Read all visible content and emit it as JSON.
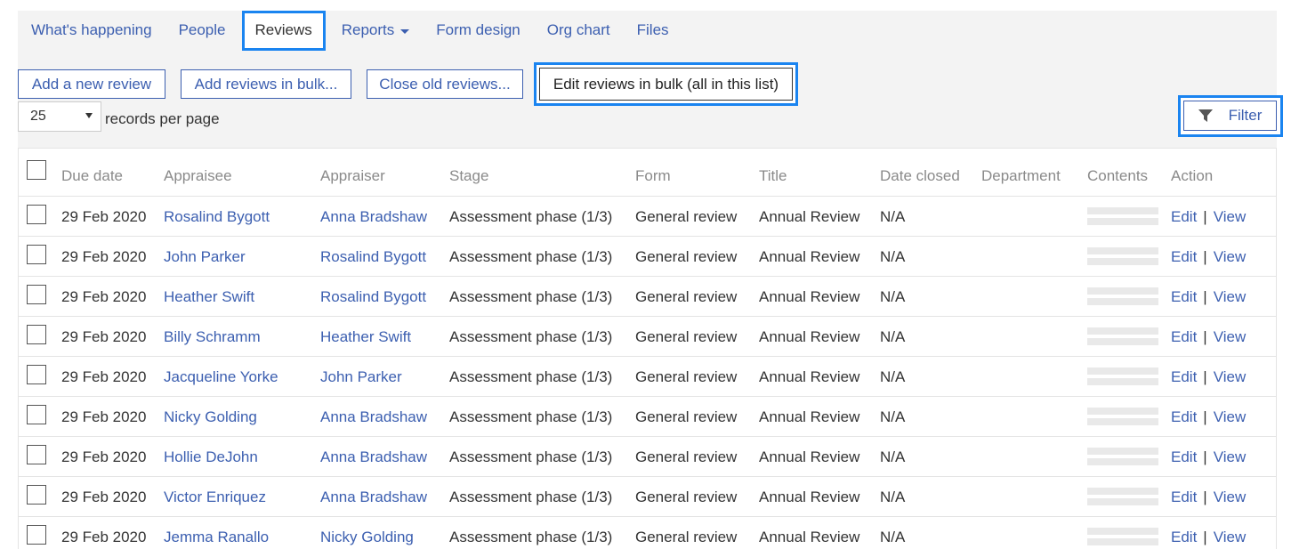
{
  "nav": {
    "items": [
      {
        "label": "What's happening"
      },
      {
        "label": "People"
      },
      {
        "label": "Reviews"
      },
      {
        "label": "Reports"
      },
      {
        "label": "Form design"
      },
      {
        "label": "Org chart"
      },
      {
        "label": "Files"
      }
    ]
  },
  "toolbar": {
    "add_review": "Add a new review",
    "add_bulk": "Add reviews in bulk...",
    "close_old": "Close old reviews...",
    "edit_bulk": "Edit reviews in bulk (all in this list)"
  },
  "perpage": {
    "value": "25",
    "label": "records per page"
  },
  "filter": {
    "label": "Filter"
  },
  "table": {
    "columns": [
      "Due date",
      "Appraisee",
      "Appraiser",
      "Stage",
      "Form",
      "Title",
      "Date closed",
      "Department",
      "Contents",
      "Action"
    ],
    "rows": [
      {
        "due": "29 Feb 2020",
        "appraisee": "Rosalind Bygott",
        "appraiser": "Anna Bradshaw",
        "stage": "Assessment phase (1/3)",
        "form": "General review",
        "title": "Annual Review",
        "closed": "N/A",
        "department": "",
        "edit": "Edit",
        "sep": "|",
        "view": "View"
      },
      {
        "due": "29 Feb 2020",
        "appraisee": "John Parker",
        "appraiser": "Rosalind Bygott",
        "stage": "Assessment phase (1/3)",
        "form": "General review",
        "title": "Annual Review",
        "closed": "N/A",
        "department": "",
        "edit": "Edit",
        "sep": "|",
        "view": "View"
      },
      {
        "due": "29 Feb 2020",
        "appraisee": "Heather Swift",
        "appraiser": "Rosalind Bygott",
        "stage": "Assessment phase (1/3)",
        "form": "General review",
        "title": "Annual Review",
        "closed": "N/A",
        "department": "",
        "edit": "Edit",
        "sep": "|",
        "view": "View"
      },
      {
        "due": "29 Feb 2020",
        "appraisee": "Billy Schramm",
        "appraiser": "Heather Swift",
        "stage": "Assessment phase (1/3)",
        "form": "General review",
        "title": "Annual Review",
        "closed": "N/A",
        "department": "",
        "edit": "Edit",
        "sep": "|",
        "view": "View"
      },
      {
        "due": "29 Feb 2020",
        "appraisee": "Jacqueline Yorke",
        "appraiser": "John Parker",
        "stage": "Assessment phase (1/3)",
        "form": "General review",
        "title": "Annual Review",
        "closed": "N/A",
        "department": "",
        "edit": "Edit",
        "sep": "|",
        "view": "View"
      },
      {
        "due": "29 Feb 2020",
        "appraisee": "Nicky Golding",
        "appraiser": "Anna Bradshaw",
        "stage": "Assessment phase (1/3)",
        "form": "General review",
        "title": "Annual Review",
        "closed": "N/A",
        "department": "",
        "edit": "Edit",
        "sep": "|",
        "view": "View"
      },
      {
        "due": "29 Feb 2020",
        "appraisee": "Hollie DeJohn",
        "appraiser": "Anna Bradshaw",
        "stage": "Assessment phase (1/3)",
        "form": "General review",
        "title": "Annual Review",
        "closed": "N/A",
        "department": "",
        "edit": "Edit",
        "sep": "|",
        "view": "View"
      },
      {
        "due": "29 Feb 2020",
        "appraisee": "Victor Enriquez",
        "appraiser": "Anna Bradshaw",
        "stage": "Assessment phase (1/3)",
        "form": "General review",
        "title": "Annual Review",
        "closed": "N/A",
        "department": "",
        "edit": "Edit",
        "sep": "|",
        "view": "View"
      },
      {
        "due": "29 Feb 2020",
        "appraisee": "Jemma Ranallo",
        "appraiser": "Nicky Golding",
        "stage": "Assessment phase (1/3)",
        "form": "General review",
        "title": "Annual Review",
        "closed": "N/A",
        "department": "",
        "edit": "Edit",
        "sep": "|",
        "view": "View"
      }
    ]
  },
  "colors": {
    "link": "#3c5fb0",
    "highlight": "#1a84f0",
    "panel": "#f3f3f3"
  }
}
